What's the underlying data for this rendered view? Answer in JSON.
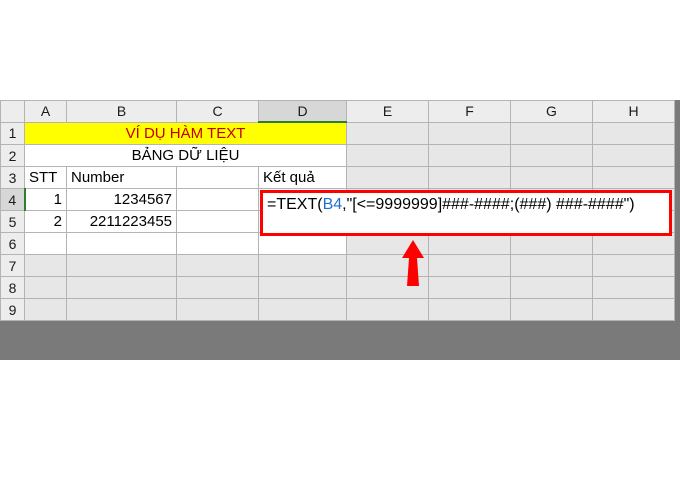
{
  "columns": [
    "A",
    "B",
    "C",
    "D",
    "E",
    "F",
    "G",
    "H"
  ],
  "rows": [
    "1",
    "2",
    "3",
    "4",
    "5",
    "6",
    "7",
    "8",
    "9"
  ],
  "active": {
    "col": "D",
    "row": "4"
  },
  "title1": "VÍ DỤ HÀM TEXT",
  "title2": "BẢNG DỮ LIỆU",
  "headers": {
    "stt": "STT",
    "number": "Number",
    "result": "Kết quả"
  },
  "data": [
    {
      "stt": "1",
      "number": "1234567"
    },
    {
      "stt": "2",
      "number": "2211223455"
    }
  ],
  "formula": {
    "prefix": "=TEXT(",
    "ref": "B4",
    "suffix": ",\"[<=9999999]###-####;(###) ###-####\")"
  },
  "chart_data": {
    "type": "table",
    "title": "VÍ DỤ HÀM TEXT — BẢNG DỮ LIỆU",
    "columns": [
      "STT",
      "Number",
      "Kết quả"
    ],
    "rows": [
      [
        "1",
        "1234567",
        "=TEXT(B4,\"[<=9999999]###-####;(###) ###-####\")"
      ],
      [
        "2",
        "2211223455",
        ""
      ]
    ]
  }
}
